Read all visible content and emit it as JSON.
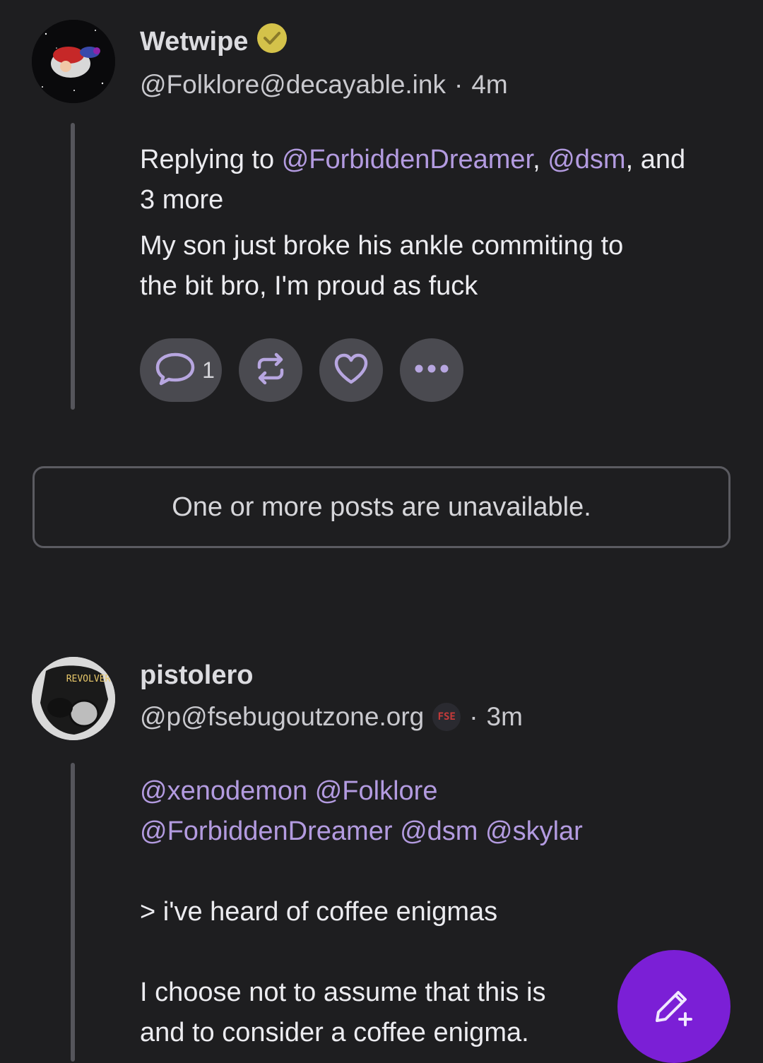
{
  "post1": {
    "display_name": "Wetwipe",
    "verified_icon": "verified-check-icon",
    "handle": "@Folklore@decayable.ink",
    "separator": "·",
    "time": "4m",
    "replying_prefix": "Replying to",
    "reply_mention_1": "@ForbiddenDreamer",
    "reply_comma": ",",
    "reply_mention_2": "@dsm",
    "reply_and": ", and",
    "reply_more": "3 more",
    "text_line_1": "My son just broke his ankle commiting to",
    "text_line_2": "the bit bro, I'm proud as fuck",
    "reply_count": "1"
  },
  "unavailable_notice": "One or more posts are unavailable.",
  "post2": {
    "display_name": "pistolero",
    "handle": "@p@fsebugoutzone.org",
    "instance_badge": "FSE",
    "separator": "·",
    "time": "3m",
    "avatar_text": "REVOLVER",
    "mentions_line_1": [
      "@xenodemon",
      "@Folklore"
    ],
    "mentions_line_2": [
      "@ForbiddenDreamer",
      "@dsm",
      "@skylar"
    ],
    "quote_line": "> i've heard of coffee enigmas",
    "text_line_1": "I choose not to assume that this is",
    "text_line_2": "and to consider a coffee enigma."
  },
  "colors": {
    "background": "#1e1e20",
    "mention": "#b39be0",
    "fab": "#7b1fd6",
    "verified": "#d4c24a"
  }
}
